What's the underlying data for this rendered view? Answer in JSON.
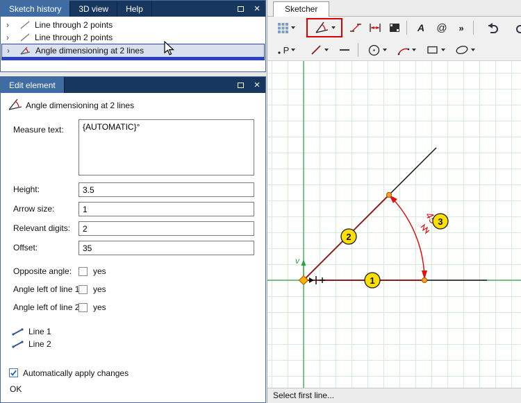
{
  "icons": {
    "expander": "›",
    "close": "×"
  },
  "history": {
    "tab_sketch_history": "Sketch history",
    "tab_3d_view": "3D view",
    "tab_help": "Help",
    "rows": [
      {
        "label": "Line through 2 points"
      },
      {
        "label": "Line through 2 points"
      },
      {
        "label": "Angle dimensioning at 2 lines"
      }
    ]
  },
  "edit": {
    "title": "Edit element",
    "header": "Angle dimensioning at 2 lines",
    "measure_text": {
      "label": "Measure text:",
      "value": "{AUTOMATIC}°"
    },
    "height": {
      "label": "Height:",
      "value": "3.5"
    },
    "arrow_size": {
      "label": "Arrow size:",
      "value": "1"
    },
    "relevant_digits": {
      "label": "Relevant digits:",
      "value": "2"
    },
    "offset": {
      "label": "Offset:",
      "value": "35"
    },
    "opposite_angle": {
      "label": "Opposite angle:",
      "value": "yes",
      "checked": false
    },
    "angle_left_1": {
      "label": "Angle left of line 1:",
      "value": "yes",
      "checked": false
    },
    "angle_left_2": {
      "label": "Angle left of line 2:",
      "value": "yes",
      "checked": false
    },
    "line1_label": "Line 1",
    "line2_label": "Line 2",
    "auto_apply_label": "Automatically apply changes",
    "auto_apply_checked": true,
    "ok_label": "OK"
  },
  "sketcher": {
    "tab": "Sketcher",
    "status": "Select first line...",
    "toolbar": {
      "text_glyph": "A",
      "at_glyph": "@",
      "more_glyph": "»",
      "point_glyph": "P"
    },
    "canvas": {
      "marker1": "1",
      "marker2": "2",
      "marker3": "3",
      "dim_text": "45°",
      "axis_v_label": "v",
      "colors": {
        "sketch_line": "#8e1c1c",
        "dimension": "#e01010",
        "marker": "#ffa524",
        "label_fill": "#ffdf00",
        "axis": "#2fa044",
        "highlight_box": "#dd0000"
      }
    }
  }
}
